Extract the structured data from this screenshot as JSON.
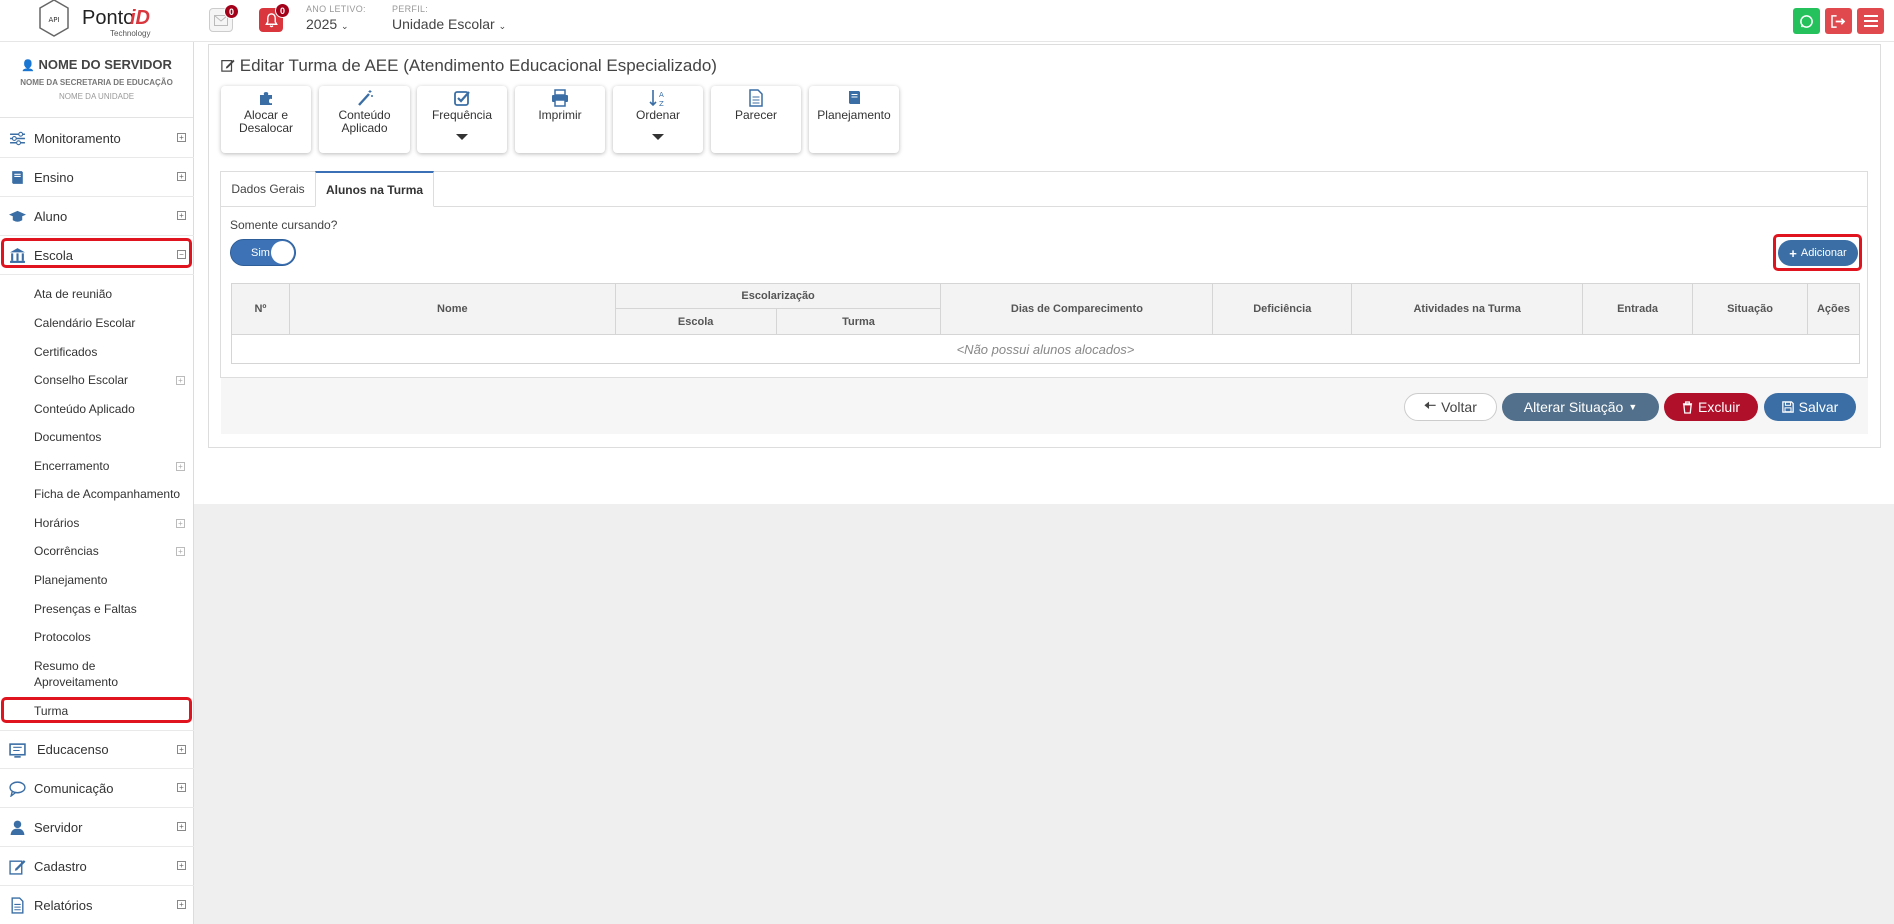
{
  "header": {
    "logo_tag": "API",
    "logo_name": "Ponto",
    "logo_name_accent": "iD",
    "logo_sub": "Technology",
    "messages_count": "0",
    "alerts_count": "0",
    "ano_letivo_label": "ANO LETIVO:",
    "ano_letivo_value": "2025",
    "perfil_label": "PERFIL:",
    "perfil_value": "Unidade Escolar",
    "icon_colors": {
      "whatsapp": "#25c15c",
      "logout": "#e04a4f",
      "menu": "#e04a4f"
    }
  },
  "profile": {
    "name": "NOME DO SERVIDOR",
    "secretaria": "NOME DA SECRETARIA DE EDUCAÇÃO",
    "unidade": "NOME DA UNIDADE"
  },
  "sidebar": {
    "items": [
      {
        "label": "Monitoramento",
        "icon": "sliders-icon"
      },
      {
        "label": "Ensino",
        "icon": "book-icon"
      },
      {
        "label": "Aluno",
        "icon": "graduation-cap-icon"
      },
      {
        "label": "Escola",
        "icon": "institution-icon",
        "expanded": true
      },
      {
        "label": "Educacenso",
        "icon": "monitor-icon"
      },
      {
        "label": "Comunicação",
        "icon": "chat-bubble-icon"
      },
      {
        "label": "Servidor",
        "icon": "user-icon"
      },
      {
        "label": "Cadastro",
        "icon": "edit-icon"
      },
      {
        "label": "Relatórios",
        "icon": "file-icon"
      }
    ],
    "escola_sub": [
      "Ata de reunião",
      "Calendário Escolar",
      "Certificados",
      "Conselho Escolar",
      "Conteúdo Aplicado",
      "Documentos",
      "Encerramento",
      "Ficha de Acompanhamento",
      "Horários",
      "Ocorrências",
      "Planejamento",
      "Presenças e Faltas",
      "Protocolos",
      "Resumo de Aproveitamento",
      "Turma"
    ]
  },
  "page": {
    "title": "Editar Turma de AEE (Atendimento Educacional Especializado)",
    "toolbar": {
      "alocar": "Alocar e Desalocar",
      "conteudo": "Conteúdo Aplicado",
      "frequencia": "Frequência",
      "imprimir": "Imprimir",
      "ordenar": "Ordenar",
      "parecer": "Parecer",
      "planejamento": "Planejamento"
    },
    "tabs": [
      "Dados Gerais",
      "Alunos na Turma"
    ],
    "somente_label": "Somente cursando?",
    "toggle_label": "Sim",
    "add_label": "Adicionar",
    "table": {
      "col_num": "Nº",
      "col_nome": "Nome",
      "col_escolarizacao": "Escolarização",
      "col_escola": "Escola",
      "col_turma": "Turma",
      "col_dias": "Dias de Comparecimento",
      "col_deficiencia": "Deficiência",
      "col_atividades": "Atividades na Turma",
      "col_entrada": "Entrada",
      "col_situacao": "Situação",
      "col_acoes": "Ações",
      "empty": "<Não possui alunos alocados>"
    },
    "footer": {
      "voltar": "Voltar",
      "alterar": "Alterar Situação",
      "excluir": "Excluir",
      "salvar": "Salvar"
    }
  }
}
